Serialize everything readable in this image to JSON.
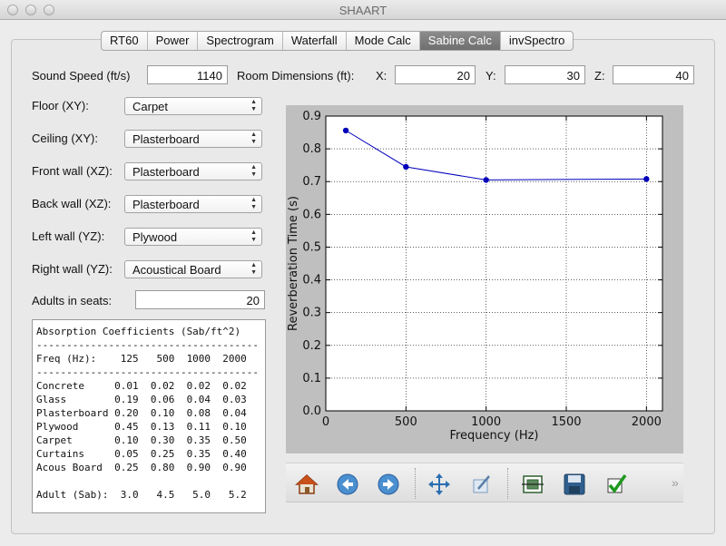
{
  "window": {
    "title": "SHAART"
  },
  "tabs": [
    {
      "label": "RT60"
    },
    {
      "label": "Power"
    },
    {
      "label": "Spectrogram"
    },
    {
      "label": "Waterfall"
    },
    {
      "label": "Mode Calc"
    },
    {
      "label": "Sabine Calc"
    },
    {
      "label": "invSpectro"
    }
  ],
  "active_tab": "Sabine Calc",
  "sound_speed": {
    "label": "Sound Speed (ft/s)",
    "value": "1140"
  },
  "room_dims": {
    "label": "Room Dimensions (ft):",
    "x_label": "X:",
    "x_value": "20",
    "y_label": "Y:",
    "y_value": "30",
    "z_label": "Z:",
    "z_value": "40"
  },
  "surfaces": [
    {
      "label": "Floor (XY):",
      "value": "Carpet"
    },
    {
      "label": "Ceiling (XY):",
      "value": "Plasterboard"
    },
    {
      "label": "Front wall (XZ):",
      "value": "Plasterboard"
    },
    {
      "label": "Back wall (XZ):",
      "value": "Plasterboard"
    },
    {
      "label": "Left wall (YZ):",
      "value": "Plywood"
    },
    {
      "label": "Right wall (YZ):",
      "value": "Acoustical Board"
    }
  ],
  "adults": {
    "label": "Adults in seats:",
    "value": "20"
  },
  "coefficients": {
    "title": "Absorption Coefficients (Sab/ft^2)",
    "dashes": "-------------------------------------",
    "header": "Freq (Hz):    125   500  1000  2000",
    "rows": [
      "Concrete     0.01  0.02  0.02  0.02",
      "Glass        0.19  0.06  0.04  0.03",
      "Plasterboard 0.20  0.10  0.08  0.04",
      "Plywood      0.45  0.13  0.11  0.10",
      "Carpet       0.10  0.30  0.35  0.50",
      "Curtains     0.05  0.25  0.35  0.40",
      "Acous Board  0.25  0.80  0.90  0.90"
    ],
    "adult_row": "Adult (Sab):  3.0   4.5   5.0   5.2"
  },
  "chart_data": {
    "type": "line",
    "title": "",
    "xlabel": "Frequency (Hz)",
    "ylabel": "Reverberation Time (s)",
    "xlim": [
      0,
      2100
    ],
    "ylim": [
      0.0,
      0.9
    ],
    "xticks": [
      0,
      500,
      1000,
      1500,
      2000
    ],
    "yticks": [
      0.0,
      0.1,
      0.2,
      0.3,
      0.4,
      0.5,
      0.6,
      0.7,
      0.8,
      0.9
    ],
    "grid": true,
    "series": [
      {
        "x": [
          125,
          500,
          1000,
          2000
        ],
        "y": [
          0.856,
          0.745,
          0.705,
          0.708
        ],
        "color": "#0000bb"
      }
    ]
  },
  "toolbar": {
    "icons": [
      "home-icon",
      "back-arrow-icon",
      "forward-arrow-icon",
      "pan-icon",
      "edit-axes-icon",
      "configure-subplots-icon",
      "save-icon",
      "checkmark-icon"
    ],
    "more": "»"
  }
}
